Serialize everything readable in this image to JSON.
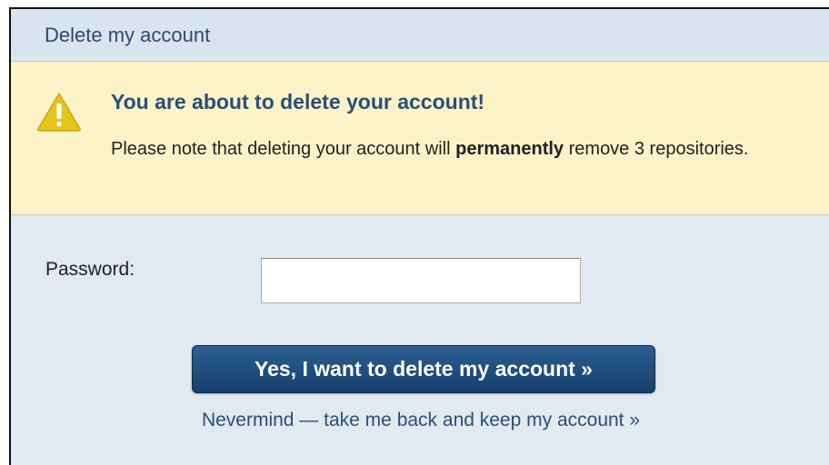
{
  "dialog": {
    "title": "Delete my account"
  },
  "warning": {
    "icon": "warning-triangle-icon",
    "title": "You are about to delete your account!",
    "body_prefix": "Please note that deleting your account will ",
    "body_emphasis": "permanently",
    "body_suffix": " remove 3 repositories."
  },
  "form": {
    "password_label": "Password:",
    "password_value": "",
    "delete_button_label": "Yes, I want to delete my account »",
    "cancel_link_label": "Nevermind — take me back and keep my account »"
  },
  "colors": {
    "warning_background": "#fbf2c7",
    "panel_background": "#e1e9f1",
    "button_background": "#1d4a7a",
    "link_text": "#2a4f78",
    "warning_icon": "#e8c51d"
  }
}
